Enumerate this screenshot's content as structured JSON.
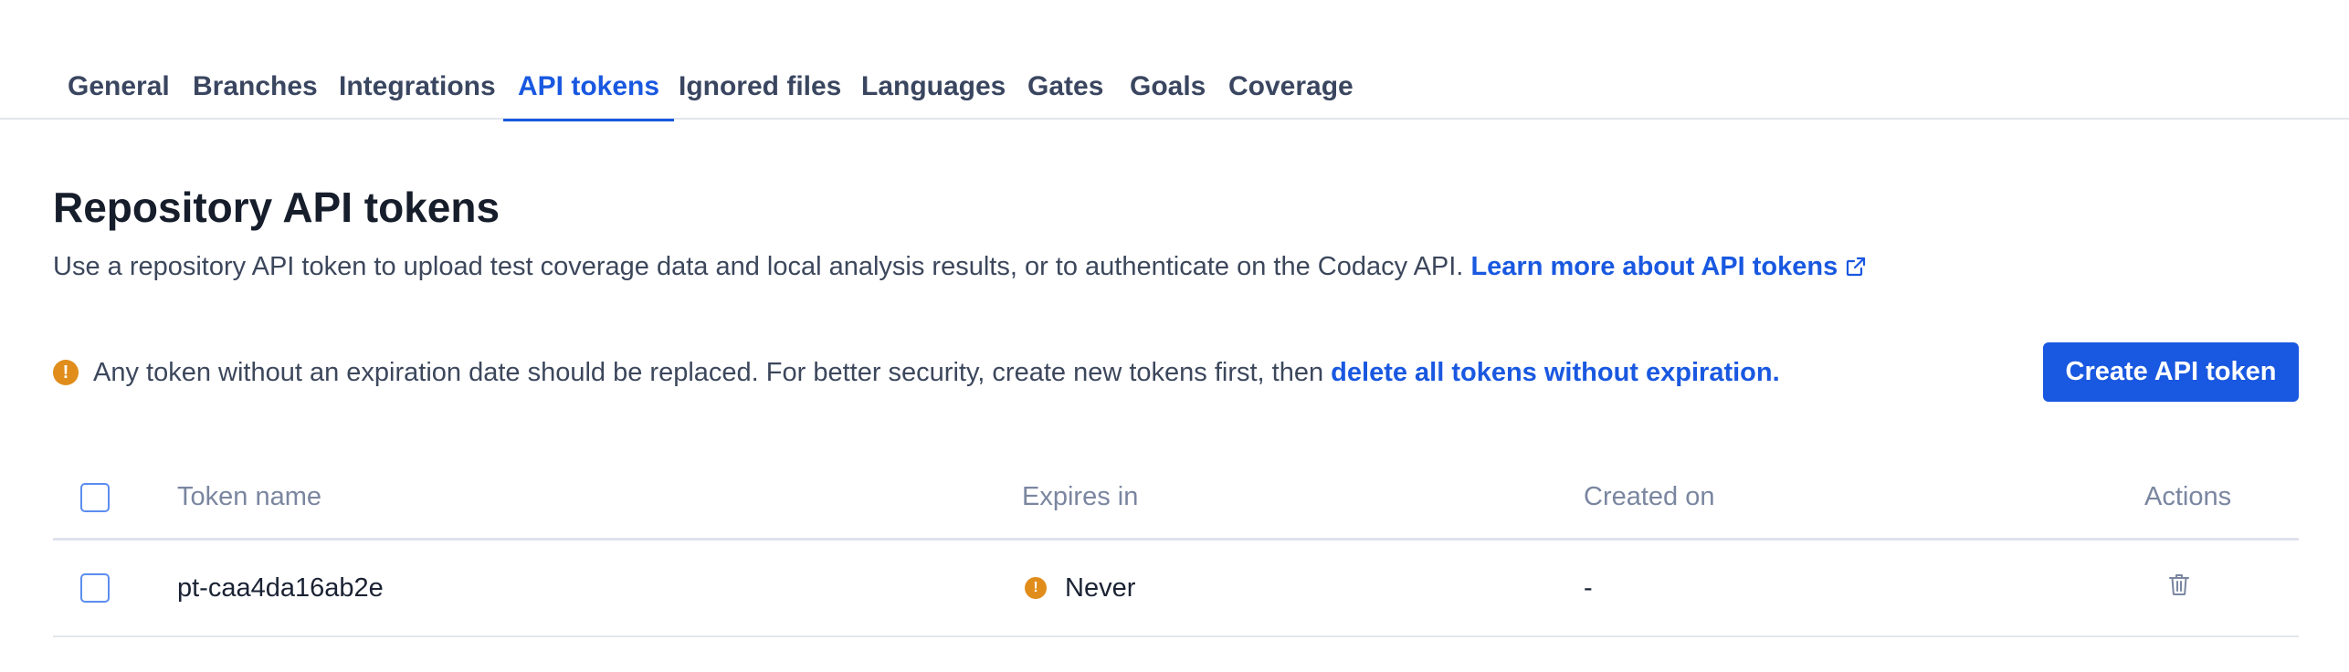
{
  "tabs": [
    {
      "label": "General",
      "active": false
    },
    {
      "label": "Branches",
      "active": false
    },
    {
      "label": "Integrations",
      "active": false
    },
    {
      "label": "API tokens",
      "active": true
    },
    {
      "label": "Ignored files",
      "active": false
    },
    {
      "label": "Languages",
      "active": false
    },
    {
      "label": "Gates",
      "active": false
    },
    {
      "label": "Goals",
      "active": false
    },
    {
      "label": "Coverage",
      "active": false
    }
  ],
  "page": {
    "title": "Repository API tokens",
    "description": "Use a repository API token to upload test coverage data and local analysis results, or to authenticate on the Codacy API.",
    "learn_more_link": "Learn more about API tokens"
  },
  "warning": {
    "icon": "!",
    "text": "Any token without an expiration date should be replaced. For better security, create new tokens first, then",
    "link": "delete all tokens without expiration."
  },
  "create_button": "Create API token",
  "table": {
    "columns": [
      "Token name",
      "Expires in",
      "Created on",
      "Actions"
    ],
    "rows": [
      {
        "name": "pt-caa4da16ab2e",
        "expires": "Never",
        "expires_icon": "!",
        "created": "-"
      }
    ]
  },
  "colors": {
    "accent": "#1958e0",
    "warning": "#e08d1c",
    "header_text": "#7a86a0",
    "divider": "#e3e6ec"
  },
  "icons": {
    "external_link": "external-link-icon",
    "warning": "warning-icon",
    "delete": "trash-icon"
  }
}
